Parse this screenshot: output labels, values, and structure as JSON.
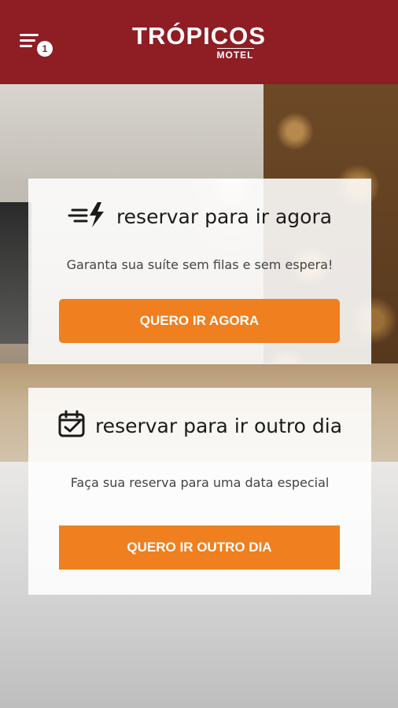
{
  "header": {
    "brand": "TRÓPICOS",
    "sub": "MOTEL",
    "notification_count": "1",
    "menu_icon": "menu-icon"
  },
  "cards": [
    {
      "icon": "fast-lightning-icon",
      "title": "reservar para ir agora",
      "subtitle": "Garanta sua suíte sem filas e sem espera!",
      "button": "QUERO IR AGORA"
    },
    {
      "icon": "calendar-check-icon",
      "title": "reservar para ir outro dia",
      "subtitle": "Faça sua reserva para uma data especial",
      "button": "QUERO IR OUTRO DIA"
    }
  ],
  "colors": {
    "header": "#8e1d24",
    "accent": "#ef7f1f"
  }
}
